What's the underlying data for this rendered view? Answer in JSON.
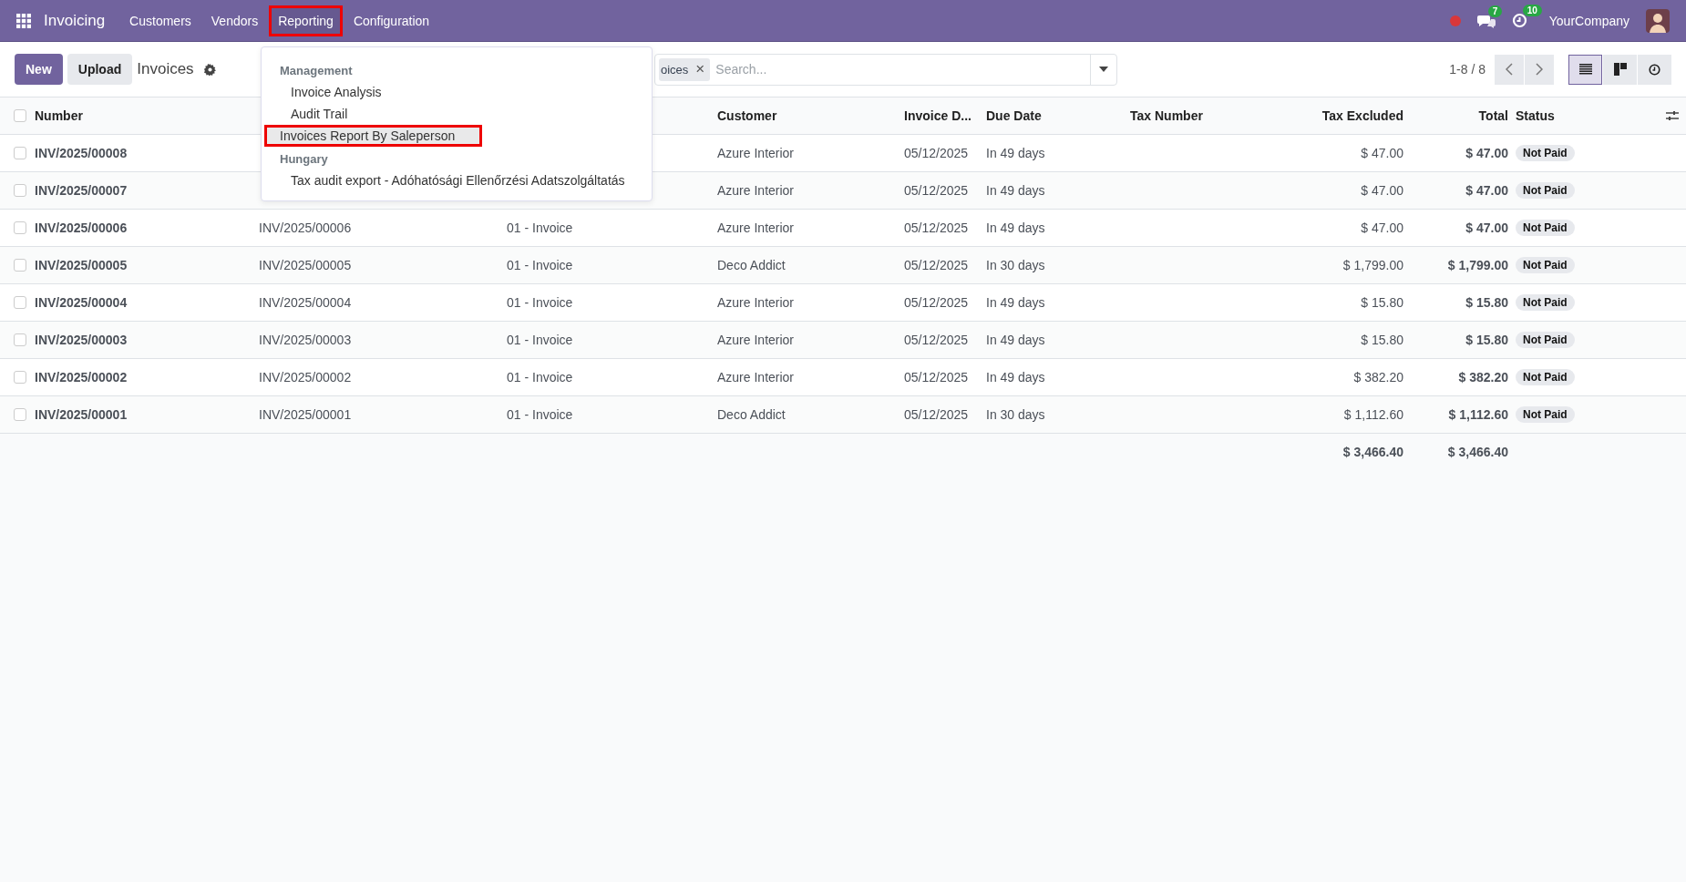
{
  "navbar": {
    "app_name": "Invoicing",
    "menus": [
      {
        "label": "Customers",
        "highlighted": false
      },
      {
        "label": "Vendors",
        "highlighted": false
      },
      {
        "label": "Reporting",
        "highlighted": true
      },
      {
        "label": "Configuration",
        "highlighted": false
      }
    ],
    "chat_badge": "7",
    "activity_badge": "10",
    "company": "YourCompany"
  },
  "control_panel": {
    "buttons": [
      "New",
      "Upload"
    ],
    "breadcrumb": "Invoices",
    "search": {
      "facet": "oices",
      "facet_remove": "×",
      "placeholder": "Search..."
    },
    "pager": "1-8 / 8",
    "views": [
      {
        "kind": "list",
        "selected": true
      },
      {
        "kind": "kanban",
        "selected": false
      },
      {
        "kind": "activity",
        "selected": false
      }
    ]
  },
  "reporting_menu": [
    {
      "title": "Management",
      "items": [
        {
          "label": "Invoice Analysis",
          "selected": false,
          "highlighted": false
        },
        {
          "label": "Audit Trail",
          "selected": false,
          "highlighted": false
        },
        {
          "label": "Invoices Report By Saleperson",
          "selected": true,
          "highlighted": true
        }
      ]
    },
    {
      "title": "Hungary",
      "items": [
        {
          "label": "Tax audit export - Adóhatósági Ellenőrzési Adatszolgáltatás",
          "selected": false,
          "highlighted": false
        }
      ]
    }
  ],
  "table": {
    "select_all_checked": false,
    "columns": {
      "number": "Number",
      "customer": "Customer",
      "invoice_date": "Invoice D...",
      "due_date": "Due Date",
      "tax_number": "Tax Number",
      "tax_excluded": "Tax Excluded",
      "total": "Total",
      "status": "Status"
    },
    "rows": [
      {
        "checked": false,
        "number": "INV/2025/00008",
        "customer": "Azure Interior",
        "invoice_date": "05/12/2025",
        "due_date": "In 49 days",
        "tax_excluded": "$ 47.00",
        "total": "$ 47.00",
        "status": "Not Paid"
      },
      {
        "checked": false,
        "number": "INV/2025/00007",
        "customer": "Azure Interior",
        "invoice_date": "05/12/2025",
        "due_date": "In 49 days",
        "tax_excluded": "$ 47.00",
        "total": "$ 47.00",
        "status": "Not Paid"
      },
      {
        "checked": false,
        "number": "INV/2025/00006",
        "column_2": "INV/2025/00006",
        "column_3": "01 - Invoice",
        "customer": "Azure Interior",
        "invoice_date": "05/12/2025",
        "due_date": "In 49 days",
        "tax_excluded": "$ 47.00",
        "total": "$ 47.00",
        "status": "Not Paid"
      },
      {
        "checked": false,
        "number": "INV/2025/00005",
        "column_2": "INV/2025/00005",
        "column_3": "01 - Invoice",
        "customer": "Deco Addict",
        "invoice_date": "05/12/2025",
        "due_date": "In 30 days",
        "tax_excluded": "$ 1,799.00",
        "total": "$ 1,799.00",
        "status": "Not Paid"
      },
      {
        "checked": false,
        "number": "INV/2025/00004",
        "column_2": "INV/2025/00004",
        "column_3": "01 - Invoice",
        "customer": "Azure Interior",
        "invoice_date": "05/12/2025",
        "due_date": "In 49 days",
        "tax_excluded": "$ 15.80",
        "total": "$ 15.80",
        "status": "Not Paid"
      },
      {
        "checked": false,
        "number": "INV/2025/00003",
        "column_2": "INV/2025/00003",
        "column_3": "01 - Invoice",
        "customer": "Azure Interior",
        "invoice_date": "05/12/2025",
        "due_date": "In 49 days",
        "tax_excluded": "$ 15.80",
        "total": "$ 15.80",
        "status": "Not Paid"
      },
      {
        "checked": false,
        "number": "INV/2025/00002",
        "column_2": "INV/2025/00002",
        "column_3": "01 - Invoice",
        "customer": "Azure Interior",
        "invoice_date": "05/12/2025",
        "due_date": "In 49 days",
        "tax_excluded": "$ 382.20",
        "total": "$ 382.20",
        "status": "Not Paid"
      },
      {
        "checked": false,
        "number": "INV/2025/00001",
        "column_2": "INV/2025/00001",
        "column_3": "01 - Invoice",
        "customer": "Deco Addict",
        "invoice_date": "05/12/2025",
        "due_date": "In 30 days",
        "tax_excluded": "$ 1,112.60",
        "total": "$ 1,112.60",
        "status": "Not Paid"
      }
    ],
    "totals": {
      "tax_excluded": "$ 3,466.40",
      "total": "$ 3,466.40"
    }
  }
}
